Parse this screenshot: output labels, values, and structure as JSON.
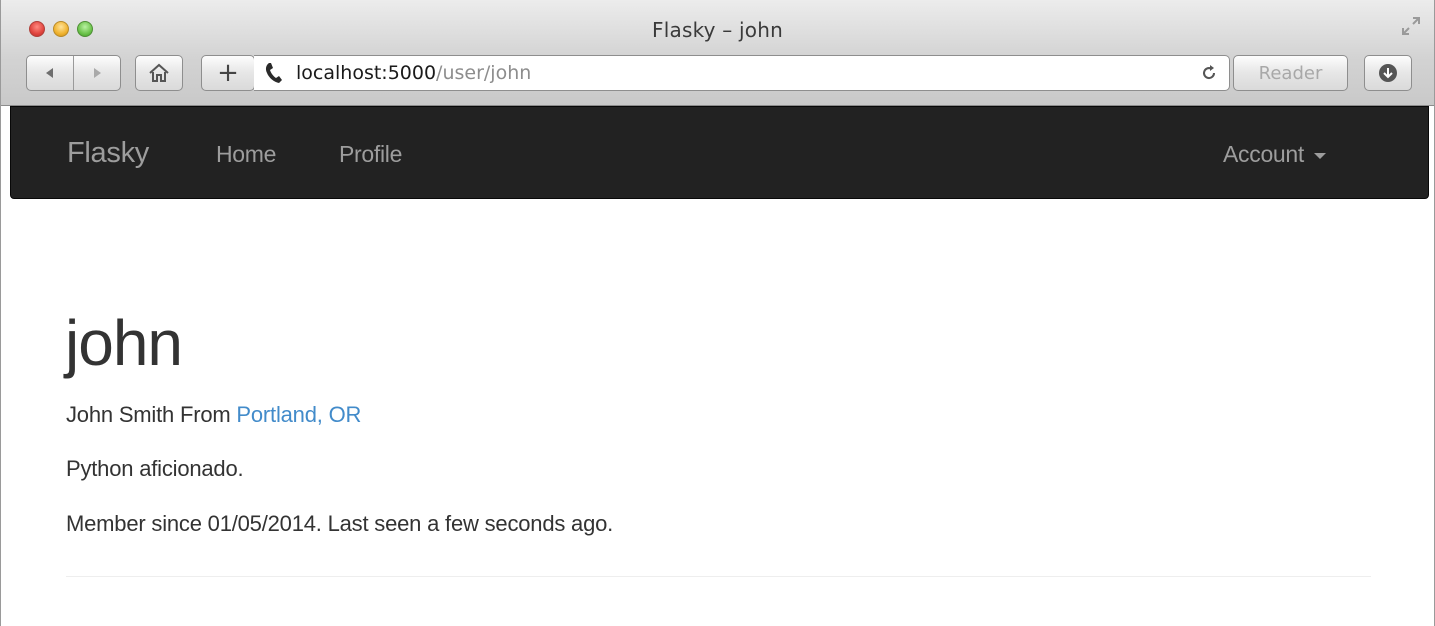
{
  "window": {
    "title": "Flasky – john"
  },
  "toolbar": {
    "add_label": "+",
    "url_host": "localhost:5000",
    "url_path": "/user/john",
    "reader_label": "Reader"
  },
  "navbar": {
    "brand": "Flasky",
    "items": [
      {
        "label": "Home"
      },
      {
        "label": "Profile"
      }
    ],
    "account_label": "Account"
  },
  "profile": {
    "username": "john",
    "name_prefix": "John Smith From ",
    "location": "Portland, OR",
    "about": "Python aficionado.",
    "member_line": "Member since 01/05/2014. Last seen a few seconds ago."
  },
  "colors": {
    "navbar_bg": "#222222",
    "nav_text": "#9d9d9d",
    "link": "#428bca",
    "text": "#333333"
  },
  "icons": [
    "back-icon",
    "forward-icon",
    "home-icon",
    "phone-icon",
    "reload-icon",
    "download-icon",
    "fullscreen-icon"
  ]
}
